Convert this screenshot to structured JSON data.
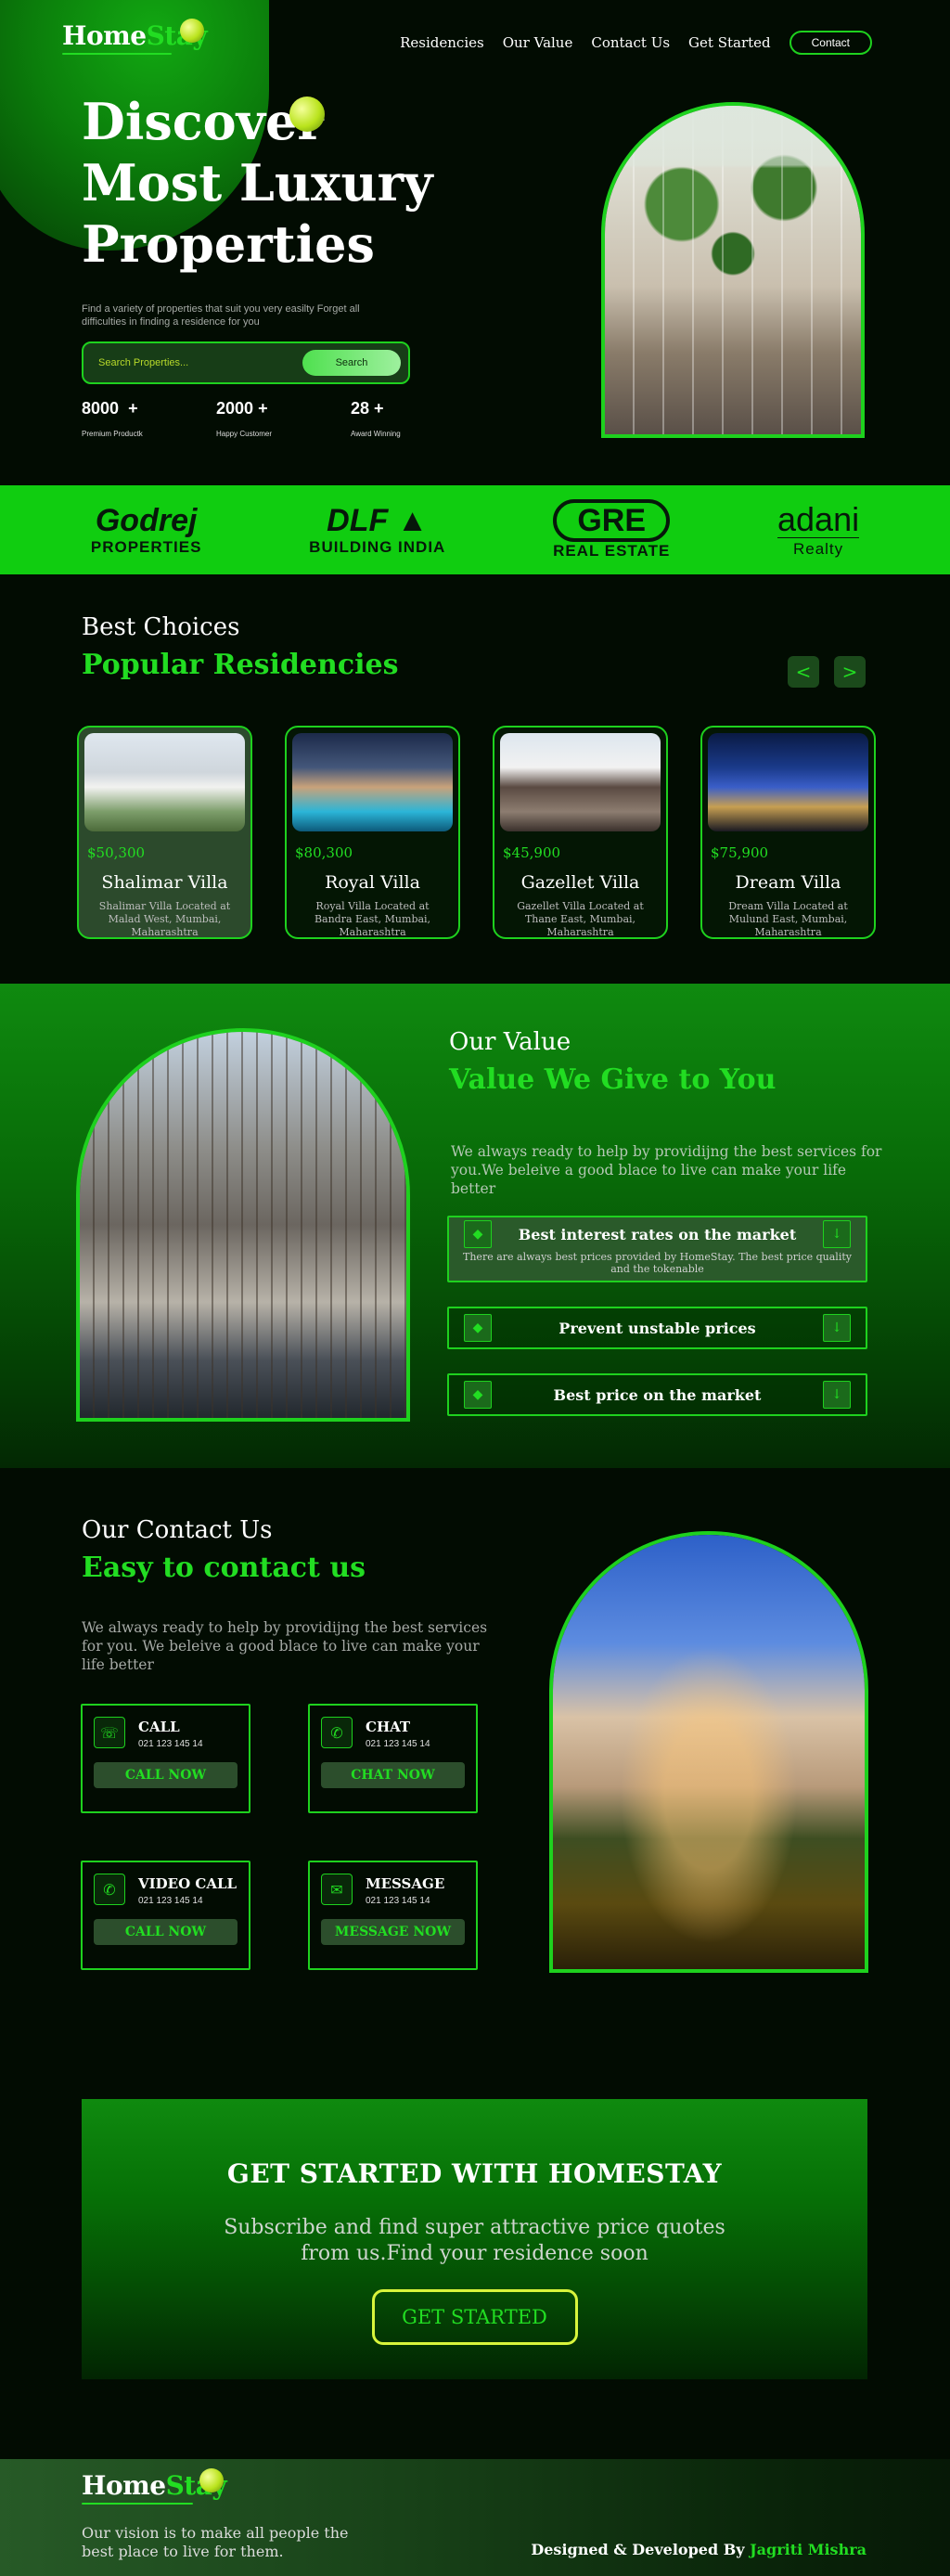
{
  "brand": {
    "home": "Home",
    "stay": "Stay"
  },
  "nav": {
    "links": [
      "Residencies",
      "Our Value",
      "Contact Us",
      "Get Started"
    ],
    "contact_label": "Contact"
  },
  "hero": {
    "title_line1": "Discover",
    "title_line2": "Most Luxury",
    "title_line3": "Properties",
    "description": "Find a variety of properties that suit you very easilty Forget all difficulties in finding a residence for you",
    "search_placeholder": "Search Properties...",
    "search_button": "Search",
    "stats": [
      {
        "value": "8000",
        "suffix": "+",
        "label": "Premium Productk"
      },
      {
        "value": "2000",
        "suffix": "+",
        "label": "Happy Customer"
      },
      {
        "value": "28",
        "suffix": "+",
        "label": "Award Winning"
      }
    ]
  },
  "brands": [
    {
      "name": "Godrej",
      "sub": "PROPERTIES"
    },
    {
      "name": "DLF",
      "sub": "BUILDING INDIA"
    },
    {
      "name": "GRE",
      "sub": "REAL ESTATE"
    },
    {
      "name": "adani",
      "sub": "Realty"
    }
  ],
  "residencies": {
    "label": "Best Choices",
    "title": "Popular Residencies",
    "prev": "<",
    "next": ">",
    "items": [
      {
        "price": "$50,300",
        "name": "Shalimar Villa",
        "address": "Shalimar Villa Located at Malad West, Mumbai, Maharashtra"
      },
      {
        "price": "$80,300",
        "name": "Royal Villa",
        "address": "Royal Villa Located at Bandra East, Mumbai, Maharashtra"
      },
      {
        "price": "$45,900",
        "name": "Gazellet Villa",
        "address": "Gazellet Villa Located at Thane East, Mumbai, Maharashtra"
      },
      {
        "price": "$75,900",
        "name": "Dream Villa",
        "address": "Dream Villa Located at Mulund East, Mumbai, Maharashtra"
      }
    ]
  },
  "value": {
    "label": "Our Value",
    "title": "Value We Give to You",
    "description": "We always ready to help by providijng the best services for you.We beleive a good blace to live can make your life better",
    "items": [
      {
        "question": "Best interest rates on the market",
        "answer": "There are always best prices provided by HomeStay. The best price quality and the tokenable"
      },
      {
        "question": "Prevent unstable prices",
        "answer": ""
      },
      {
        "question": "Best price on the market",
        "answer": ""
      }
    ]
  },
  "contact": {
    "label": "Our Contact Us",
    "title": "Easy to contact us",
    "description": "We always ready to help by providijng the best services for you. We beleive a good blace to live can make your life better",
    "methods": [
      {
        "title": "CALL",
        "phone": "021 123 145 14",
        "cta": "CALL NOW",
        "icon": "☏"
      },
      {
        "title": "CHAT",
        "phone": "021 123 145 14",
        "cta": "CHAT NOW",
        "icon": "✆"
      },
      {
        "title": "VIDEO CALL",
        "phone": "021 123 145 14",
        "cta": "CALL NOW",
        "icon": "✆"
      },
      {
        "title": "MESSAGE",
        "phone": "021 123 145 14",
        "cta": "MESSAGE NOW",
        "icon": "✉"
      }
    ]
  },
  "get_started": {
    "title": "GET STARTED WITH HOMESTAY",
    "description": "Subscribe and find super attractive price quotes from us.Find your residence soon",
    "button": "GET STARTED"
  },
  "footer": {
    "vision": "Our vision is to make all people the best place to live for them.",
    "credit_prefix": "Designed & Developed By",
    "author": "Jagriti Mishra"
  },
  "colors": {
    "accent": "#22dd22",
    "background": "#020c02",
    "brand_strip": "#10cd10",
    "ball": "#b9e31c"
  }
}
